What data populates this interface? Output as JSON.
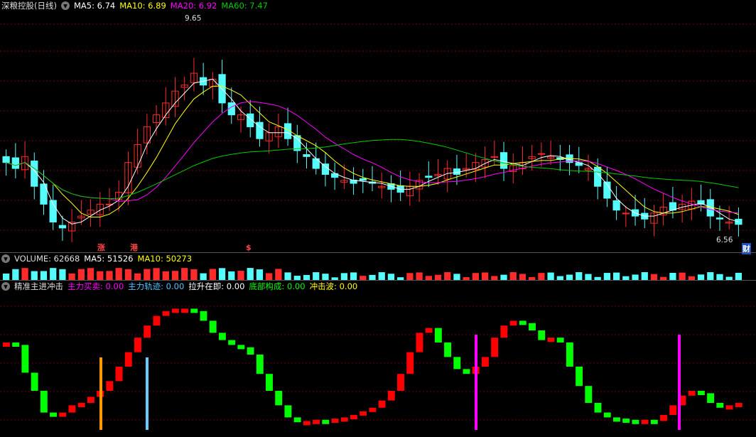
{
  "colors": {
    "up": "#ff2a2a",
    "down": "#54fcfc",
    "ma5": "#ffffff",
    "ma10": "#ffff00",
    "ma20": "#ff00ff",
    "ma60": "#00cc00",
    "grid": "#6b0000",
    "osc_up": "#ff0000",
    "osc_down": "#00ff00"
  },
  "main": {
    "title": "深粮控股(日线)",
    "ma5": "MA5: 6.74",
    "ma10": "MA10: 6.89",
    "ma20": "MA20: 6.92",
    "ma60": "MA60: 7.47",
    "high_label": "9.65",
    "low_label": "6.56",
    "marker_zhang": "涨",
    "marker_gang": "港",
    "marker_s": "$",
    "marker_cai": "财"
  },
  "volume": {
    "title": "VOLUME: 62668",
    "ma5": "MA5: 51526",
    "ma10": "MA10: 50273"
  },
  "indicator": {
    "title": "精准主进冲击",
    "l1": "主力买卖: 0.00",
    "l2": "主力轨迹: 0.00",
    "l3": "拉升在即: 0.00",
    "l4": "底部构成: 0.00",
    "l5": "冲击波: 0.00"
  },
  "chart_data": {
    "type": "candlestick",
    "price_range": [
      6.2,
      9.9
    ],
    "closes": [
      7.6,
      7.5,
      7.7,
      7.2,
      6.9,
      6.6,
      6.5,
      6.6,
      6.7,
      6.8,
      6.9,
      6.9,
      7.1,
      7.6,
      7.9,
      8.2,
      8.4,
      8.6,
      8.8,
      8.9,
      9.1,
      8.9,
      9.0,
      8.6,
      8.4,
      8.4,
      8.2,
      8.0,
      8.1,
      8.2,
      8.0,
      7.8,
      7.7,
      7.5,
      7.4,
      7.35,
      7.3,
      7.25,
      7.3,
      7.25,
      7.2,
      7.15,
      7.1,
      7.2,
      7.3,
      7.35,
      7.4,
      7.5,
      7.4,
      7.5,
      7.6,
      7.65,
      7.7,
      7.5,
      7.55,
      7.6,
      7.7,
      7.75,
      7.7,
      7.65,
      7.6,
      7.55,
      7.5,
      7.2,
      7.0,
      6.8,
      6.75,
      6.7,
      6.65,
      6.75,
      6.85,
      6.8,
      6.9,
      6.95,
      6.9,
      6.7,
      6.65,
      6.6,
      6.56
    ],
    "ma5_line": "white",
    "ma10_line": "yellow",
    "ma20_line": "magenta",
    "ma60_line": "green"
  }
}
